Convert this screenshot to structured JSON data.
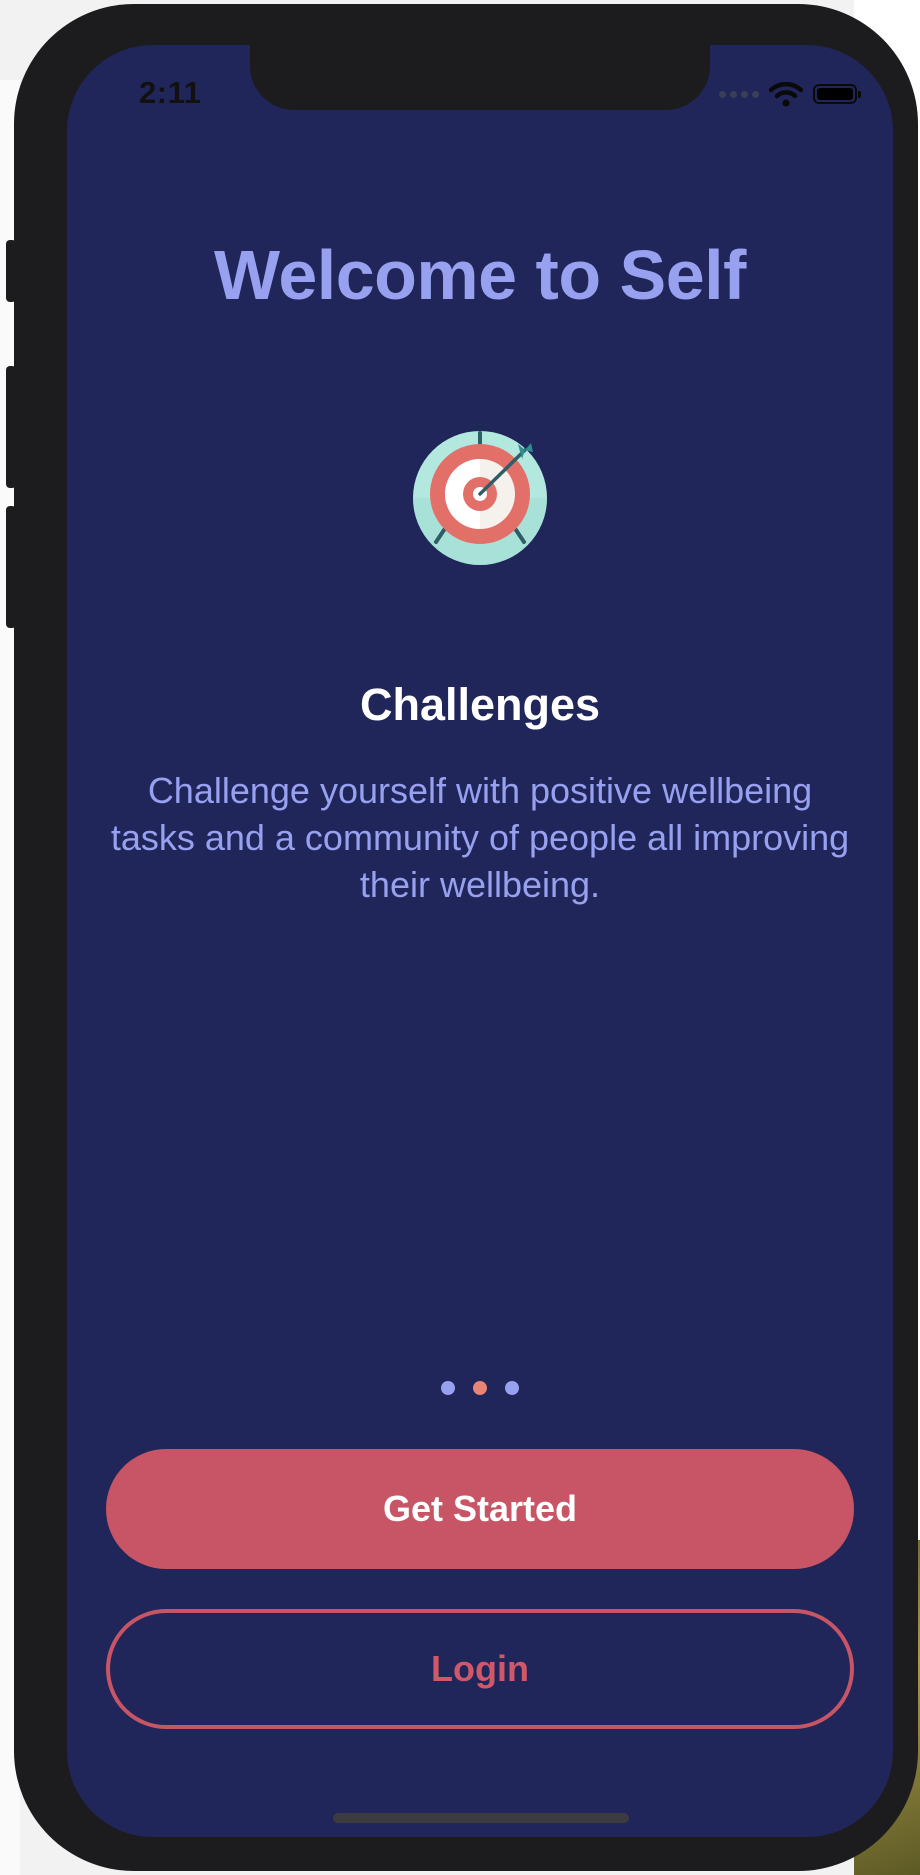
{
  "status_bar": {
    "time": "2:11"
  },
  "welcome": {
    "title": "Welcome to Self"
  },
  "feature": {
    "icon": "target-arrow-icon",
    "title": "Challenges",
    "description": "Challenge yourself with positive wellbeing tasks and a community of people all improving their wellbeing."
  },
  "pagination": {
    "total": 3,
    "current": 2
  },
  "actions": {
    "primary_label": "Get Started",
    "secondary_label": "Login"
  },
  "colors": {
    "background": "#21265a",
    "title_accent": "#98a1f0",
    "button_primary": "#c85565",
    "active_dot": "#e88475"
  }
}
